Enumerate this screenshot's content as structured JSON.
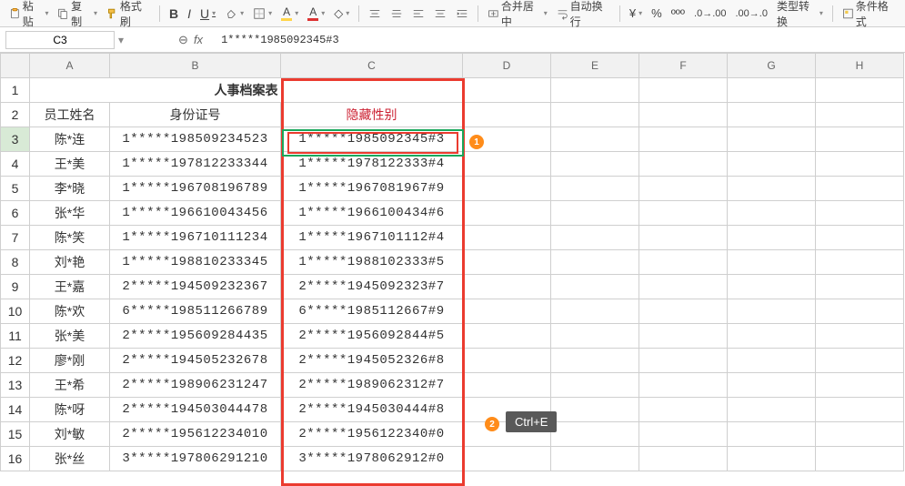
{
  "toolbar": {
    "paste": "粘贴",
    "copy": "复制",
    "format_painter": "格式刷",
    "merge_center": "合并居中",
    "wrap": "自动换行",
    "type_convert": "类型转换",
    "cond_format": "条件格式"
  },
  "namebox": "C3",
  "formula_value": "1*****1985092345#3",
  "columns": [
    "A",
    "B",
    "C",
    "D",
    "E",
    "F",
    "G",
    "H"
  ],
  "row_labels": [
    "1",
    "2",
    "3",
    "4",
    "5",
    "6",
    "7",
    "8",
    "9",
    "10",
    "11",
    "12",
    "13",
    "14",
    "15",
    "16"
  ],
  "title": "人事档案表",
  "headers": {
    "a": "员工姓名",
    "b": "身份证号",
    "c": "隐藏性别"
  },
  "rows": [
    {
      "a": "陈*连",
      "b": "1*****198509234523",
      "c": "1*****1985092345#3"
    },
    {
      "a": "王*美",
      "b": "1*****197812233344",
      "c": "1*****1978122333#4"
    },
    {
      "a": "李*晓",
      "b": "1*****196708196789",
      "c": "1*****1967081967#9"
    },
    {
      "a": "张*华",
      "b": "1*****196610043456",
      "c": "1*****1966100434#6"
    },
    {
      "a": "陈*笑",
      "b": "1*****196710111234",
      "c": "1*****1967101112#4"
    },
    {
      "a": "刘*艳",
      "b": "1*****198810233345",
      "c": "1*****1988102333#5"
    },
    {
      "a": "王*嘉",
      "b": "2*****194509232367",
      "c": "2*****1945092323#7"
    },
    {
      "a": "陈*欢",
      "b": "6*****198511266789",
      "c": "6*****1985112667#9"
    },
    {
      "a": "张*美",
      "b": "2*****195609284435",
      "c": "2*****1956092844#5"
    },
    {
      "a": "廖*刚",
      "b": "2*****194505232678",
      "c": "2*****1945052326#8"
    },
    {
      "a": "王*希",
      "b": "2*****198906231247",
      "c": "2*****1989062312#7"
    },
    {
      "a": "陈*呀",
      "b": "2*****194503044478",
      "c": "2*****1945030444#8"
    },
    {
      "a": "刘*敏",
      "b": "2*****195612234010",
      "c": "2*****1956122340#0"
    },
    {
      "a": "张*丝",
      "b": "3*****197806291210",
      "c": "3*****1978062912#0"
    }
  ],
  "callouts": {
    "badge1": "1",
    "badge2": "2",
    "tooltip": "Ctrl+E"
  }
}
